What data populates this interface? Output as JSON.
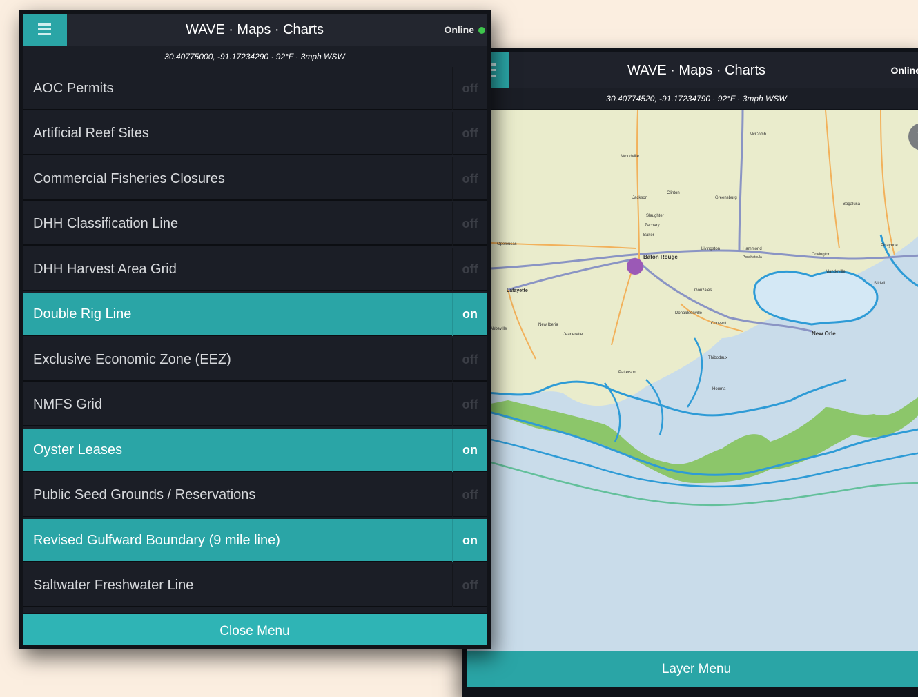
{
  "map_screen": {
    "title": "WAVE · Maps · Charts",
    "status": "Online",
    "coords_line": "30.40774520, -91.17234790  ·  92°F  ·  3mph WSW",
    "footer_button": "Layer Menu",
    "map_labels": {
      "baton_rouge": "Baton Rouge",
      "lafayette": "Lafayette",
      "new_orleans": "New Orle",
      "livingston": "Livingston",
      "hammond": "Hammond",
      "covington": "Covington",
      "gonzales": "Gonzales",
      "donaldsonville": "Donaldsonville",
      "convent": "Convent",
      "thibodaux": "Thibodaux",
      "houma": "Houma",
      "new_iberia": "New Iberia",
      "jeanerette": "Jeanerette",
      "abbeville": "Abbeville",
      "opelousas": "Opelousas",
      "patterson": "Patterson",
      "jackson": "Jackson",
      "clinton": "Clinton",
      "greensburg": "Greensburg",
      "slaughter": "Slaughter",
      "zachary": "Zachary",
      "baker": "Baker",
      "woodville": "Woodville",
      "mccomb": "McComb",
      "bogalusa": "Bogalusa",
      "picayune": "Picayune",
      "slidell": "Slidell",
      "mandeville": "Mandeville",
      "ponchatoula": "Ponchatoula"
    },
    "position_color": "#9b59b6"
  },
  "layer_screen": {
    "title": "WAVE · Maps · Charts",
    "status": "Online",
    "coords_line": "30.40775000, -91.17234290  ·  92°F  ·  3mph WSW",
    "layers": [
      {
        "label": "AOC Permits",
        "state": "off"
      },
      {
        "label": "Artificial Reef Sites",
        "state": "off"
      },
      {
        "label": "Commercial Fisheries Closures",
        "state": "off"
      },
      {
        "label": "DHH Classification Line",
        "state": "off"
      },
      {
        "label": "DHH Harvest Area Grid",
        "state": "off"
      },
      {
        "label": "Double Rig Line",
        "state": "on"
      },
      {
        "label": "Exclusive Economic Zone (EEZ)",
        "state": "off"
      },
      {
        "label": "NMFS Grid",
        "state": "off"
      },
      {
        "label": "Oyster Leases",
        "state": "on"
      },
      {
        "label": "Public Seed Grounds / Reservations",
        "state": "off"
      },
      {
        "label": "Revised Gulfward Boundary (9 mile line)",
        "state": "on"
      },
      {
        "label": "Saltwater Freshwater Line",
        "state": "off"
      }
    ],
    "close_button": "Close Menu"
  },
  "colors": {
    "accent": "#2aa5a6",
    "online_dot": "#3ec54c",
    "header": "#23262f"
  }
}
